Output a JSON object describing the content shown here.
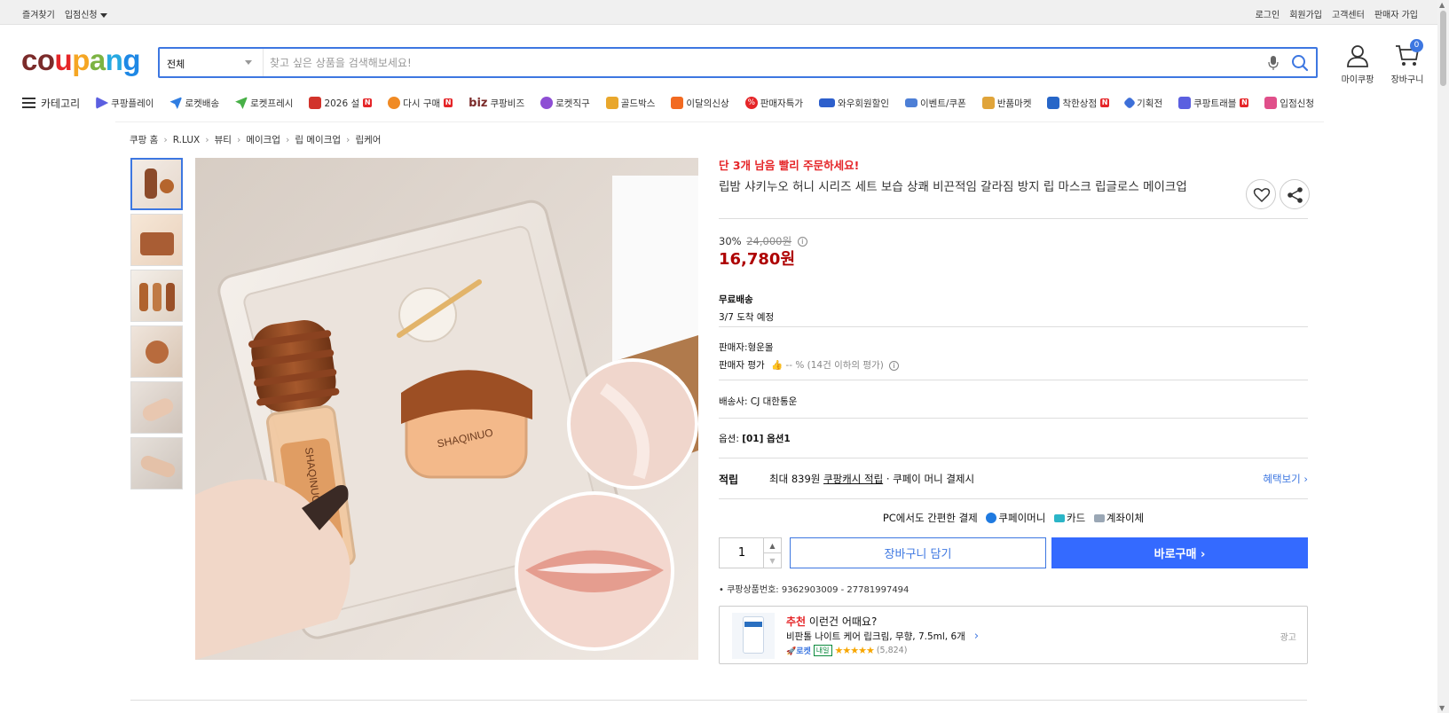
{
  "topbar": {
    "left": [
      "즐겨찾기",
      "입점신청"
    ],
    "right": [
      "로그인",
      "회원가입",
      "고객센터",
      "판매자 가입"
    ]
  },
  "header": {
    "logo": [
      "c",
      "o",
      "u",
      "p",
      "a",
      "n",
      "g"
    ],
    "logo_colors": [
      "#7b2b2a",
      "#7b2b2a",
      "#e52528",
      "#f5a623",
      "#7cb342",
      "#27a9e1",
      "#1e88e5"
    ],
    "search": {
      "category": "전체",
      "placeholder": "찾고 싶은 상품을 검색해보세요!"
    },
    "mycoupang": "마이쿠팡",
    "cart": "장바구니",
    "cart_count": "0"
  },
  "nav": {
    "category": "카테고리",
    "items": [
      {
        "label": "쿠팡플레이",
        "icon": "play-icon",
        "color": "#5b5fe0"
      },
      {
        "label": "로켓배송",
        "icon": "rocket-icon",
        "color": "#2f7de1"
      },
      {
        "label": "로켓프레시",
        "icon": "rocket-fresh-icon",
        "color": "#48b047"
      },
      {
        "label": "2026 설",
        "icon": "hanbok-icon",
        "color": "#d2332b",
        "badge": "N"
      },
      {
        "label": "다시 구매",
        "icon": "repurchase-icon",
        "color": "#f08a24",
        "badge": "N"
      },
      {
        "label": "쿠팡비즈",
        "icon": "biz-icon",
        "color": "#7b2b2a",
        "prefix": "biz"
      },
      {
        "label": "로켓직구",
        "icon": "global-icon",
        "color": "#8e4ed4"
      },
      {
        "label": "골드박스",
        "icon": "goldbox-icon",
        "color": "#e9a72c"
      },
      {
        "label": "이달의신상",
        "icon": "new-icon",
        "color": "#f26a21"
      },
      {
        "label": "판매자특가",
        "icon": "percent-icon",
        "color": "#e52528"
      },
      {
        "label": "와우회원할인",
        "icon": "wow-icon",
        "color": "#2d5fcc"
      },
      {
        "label": "이벤트/쿠폰",
        "icon": "coupon-icon",
        "color": "#4d7fd6"
      },
      {
        "label": "반품마켓",
        "icon": "market-icon",
        "color": "#e0a43a"
      },
      {
        "label": "착한상점",
        "icon": "store-icon",
        "color": "#2766c8",
        "badge": "N"
      },
      {
        "label": "기획전",
        "icon": "tag-icon",
        "color": "#3d6fd8"
      },
      {
        "label": "쿠팡트래블",
        "icon": "travel-icon",
        "color": "#5b5fe0",
        "badge": "N"
      },
      {
        "label": "입점신청",
        "icon": "shop-icon",
        "color": "#e04f8a"
      }
    ]
  },
  "breadcrumb": [
    "쿠팡 홈",
    "R.LUX",
    "뷰티",
    "메이크업",
    "립 메이크업",
    "립케어"
  ],
  "product": {
    "urgent": "단 3개 남음 빨리 주문하세요!",
    "title": "립밤 샤키누오 허니 시리즈 세트 보습 상쾌 비끈적임 갈라짐 방지 립 마스크 립글로스 메이크업",
    "discount": "30%",
    "original_price": "24,000원",
    "price": "16,780원",
    "shipping_label": "무료배송",
    "delivery": "3/7 도착 예정",
    "seller_label": "판매자:",
    "seller": "형운몰",
    "seller_rating_label": "판매자 평가",
    "seller_rating": "-- % (14건 이하의 평가)",
    "courier_label": "배송사:",
    "courier": "CJ 대한통운",
    "option_label": "옵션:",
    "option": "[01] 옵션1",
    "image_label_1": "SHAQINUO",
    "image_label_2": "SHAQINUO"
  },
  "earn": {
    "label": "적립",
    "max": "최대 839원",
    "cash": "쿠팡캐시 적립",
    "suffix": "· 쿠페이 머니 결제시",
    "benefit": "혜택보기"
  },
  "payment": {
    "title": "PC에서도 간편한 결제",
    "methods": [
      "쿠페이머니",
      "카드",
      "계좌이체"
    ]
  },
  "purchase": {
    "qty": "1",
    "add_to_cart": "장바구니 담기",
    "buy_now": "바로구매"
  },
  "product_id": "쿠팡상품번호: 9362903009 - 27781997494",
  "recommend": {
    "title_red": "추천",
    "title_rest": "이런건 어때요?",
    "name": "비판톨 나이트 케어 립크림, 무향, 7.5ml, 6개",
    "rocket": "로켓",
    "tag": "내일",
    "rating": 5,
    "reviews": "(5,824)",
    "ad": "광고"
  }
}
